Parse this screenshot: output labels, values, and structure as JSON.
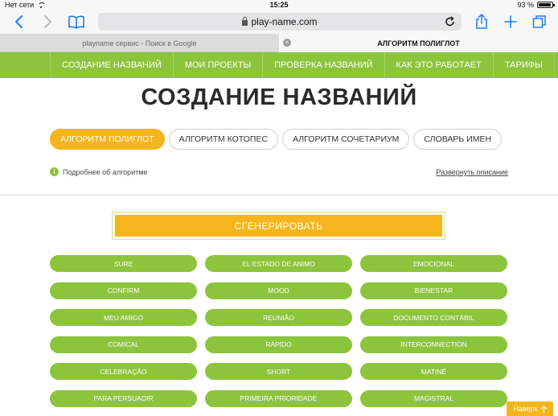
{
  "status_bar": {
    "carrier": "Нет сети",
    "time": "15:25",
    "battery": "93 %",
    "battery_level": 0.93
  },
  "browser": {
    "url": "play-name.com",
    "back_icon": "chevron-left-icon",
    "forward_icon": "chevron-right-icon",
    "bookmarks_icon": "book-icon",
    "lock_icon": "lock-icon",
    "reload_icon": "reload-icon",
    "share_icon": "share-icon",
    "new_tab_icon": "plus-icon",
    "tabs_icon": "tabs-icon",
    "accent_color": "#1a7ef7",
    "tabs": [
      {
        "title": "playname сервис - Поиск в Google",
        "active": false
      },
      {
        "title": "АЛГОРИТМ ПОЛИГЛОТ",
        "active": true
      }
    ]
  },
  "nav": {
    "color": "#8cc43c",
    "items": [
      {
        "label": "СОЗДАНИЕ НАЗВАНИЙ"
      },
      {
        "label": "МОИ ПРОЕКТЫ"
      },
      {
        "label": "ПРОВЕРКА НАЗВАНИЙ"
      },
      {
        "label": "КАК ЭТО РАБОТАЕТ"
      },
      {
        "label": "ТАРИФЫ"
      }
    ]
  },
  "page": {
    "title": "СОЗДАНИЕ НАЗВАНИЙ",
    "algorithms": [
      {
        "label": "АЛГОРИТМ ПОЛИГЛОТ",
        "active": true
      },
      {
        "label": "АЛГОРИТМ КОТОПЕС",
        "active": false
      },
      {
        "label": "АЛГОРИТМ СОЧЕТАРИУМ",
        "active": false
      },
      {
        "label": "СЛОВАРЬ ИМЕН",
        "active": false
      }
    ],
    "info_text": "Подробнее об алгоритме",
    "info_icon": "info-icon",
    "expand_link": "Развернуть описание",
    "generate_label": "СГЕНЕРИРОВАТЬ",
    "accent_color": "#f6b51e",
    "names": [
      "SURE",
      "EL ESTADO DE ANIMO",
      "EMOCIONAL",
      "CONFIRM",
      "MOOD",
      "BIENESTAR",
      "MEU AMIGO",
      "REUNIÃO",
      "DOCUMENTO CONTÁBIL",
      "COMICAL",
      "RÁPIDO",
      "INTERCONNECTION",
      "CELEBRAÇÃO",
      "SHORT",
      "MATINÊ",
      "PARA PERSUADIR",
      "PRIMEIRA PRIORIDADE",
      "MAGISTRAL"
    ],
    "back_to_top": "Наверх",
    "back_to_top_icon": "arrow-up-icon"
  }
}
